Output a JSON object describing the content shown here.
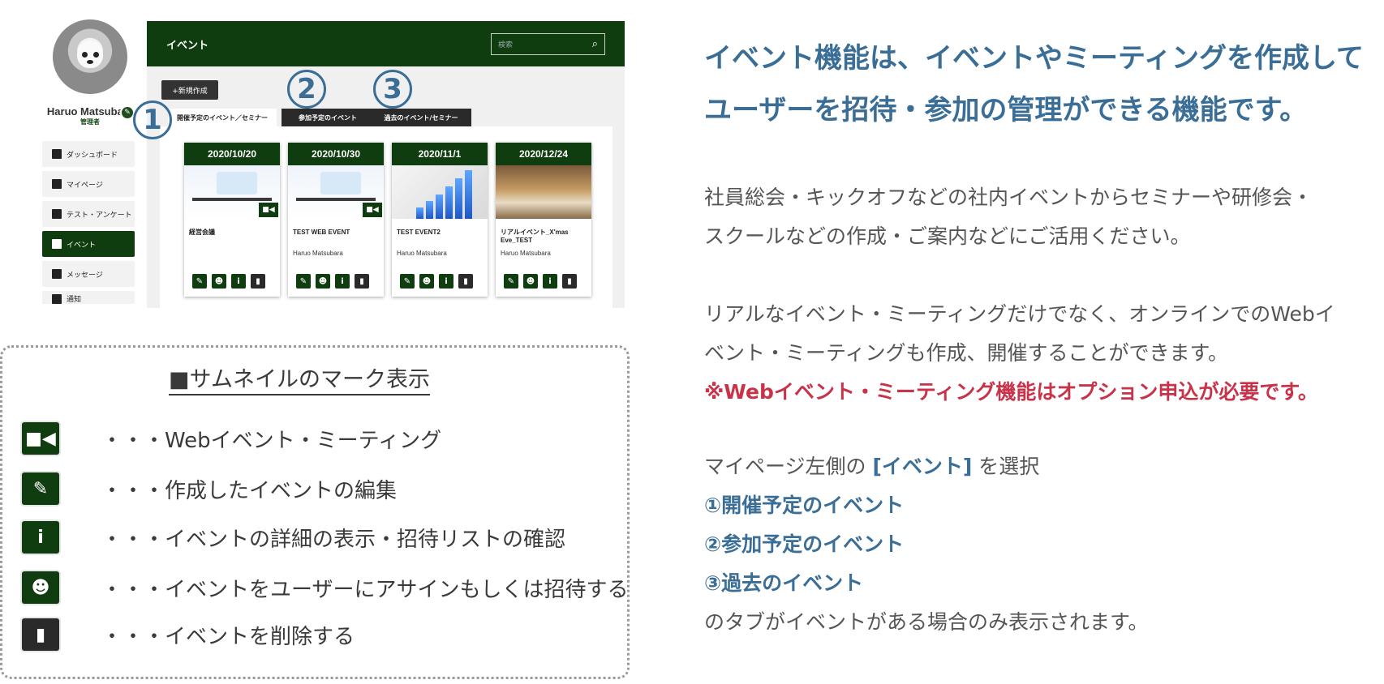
{
  "app": {
    "user": {
      "name": "Haruo Matsubara",
      "role": "管理者"
    },
    "nav": [
      {
        "label": "ダッシュボード",
        "icon": "dashboard-icon"
      },
      {
        "label": "マイページ",
        "icon": "book-icon"
      },
      {
        "label": "テスト・アンケート",
        "icon": "list-icon"
      },
      {
        "label": "イベント",
        "icon": "megaphone-icon",
        "active": true
      },
      {
        "label": "メッセージ",
        "icon": "chat-icon"
      },
      {
        "label": "通知",
        "icon": "bell-icon"
      }
    ],
    "header": {
      "title": "イベント",
      "search_placeholder": "検索"
    },
    "new_button": "+新規作成",
    "tabs": [
      "開催予定のイベント／セミナー",
      "参加予定のイベント",
      "過去のイベント/セミナー"
    ],
    "markers": [
      "①",
      "②",
      "③"
    ],
    "events": [
      {
        "date": "2020/10/20",
        "name": "経営会議",
        "owner": "",
        "web": true,
        "thumb": "illustration"
      },
      {
        "date": "2020/10/30",
        "name": "TEST WEB EVENT",
        "owner": "Haruo Matsubara",
        "web": true,
        "thumb": "illustration"
      },
      {
        "date": "2020/11/1",
        "name": "TEST EVENT2",
        "owner": "Haruo Matsubara",
        "web": false,
        "thumb": "growth-graph"
      },
      {
        "date": "2020/12/24",
        "name": "リアルイベント_X'mas Eve_TEST",
        "owner": "Haruo Matsubara",
        "web": false,
        "thumb": "photo"
      }
    ]
  },
  "legend": {
    "title": "■サムネイルのマーク表示",
    "items": [
      {
        "icon": "video-camera-icon",
        "text": "・・・Webイベント・ミーティング"
      },
      {
        "icon": "pencil-icon",
        "text": "・・・作成したイベントの編集"
      },
      {
        "icon": "info-icon",
        "text": "・・・イベントの詳細の表示・招待リストの確認"
      },
      {
        "icon": "users-icon",
        "text": "・・・イベントをユーザーにアサインもしくは招待する"
      },
      {
        "icon": "trash-icon",
        "text": "・・・イベントを削除する"
      }
    ]
  },
  "description": {
    "headline_1": "イベント機能は、イベントやミーティングを作成して",
    "headline_2": "ユーザーを招待・参加の管理ができる機能です。",
    "p1_line1": "社員総会・キックオフなどの社内イベントからセミナーや研修会・",
    "p1_line2": "スクールなどの作成・ご案内などにご活用ください。",
    "p2_line1": "リアルなイベント・ミーティングだけでなく、オンラインでのWebイ",
    "p2_line2": "ベント・ミーティングも作成、開催することができます。",
    "notice": "※Webイベント・ミーティング機能はオプション申込が必要です。",
    "select_prefix": "マイページ左側の",
    "select_bracket": "[イベント]",
    "select_suffix": "を選択",
    "list_1": "①開催予定のイベント",
    "list_2": "②参加予定のイベント",
    "list_3": "③過去のイベント",
    "footer": "のタブがイベントがある場合のみ表示されます。"
  }
}
